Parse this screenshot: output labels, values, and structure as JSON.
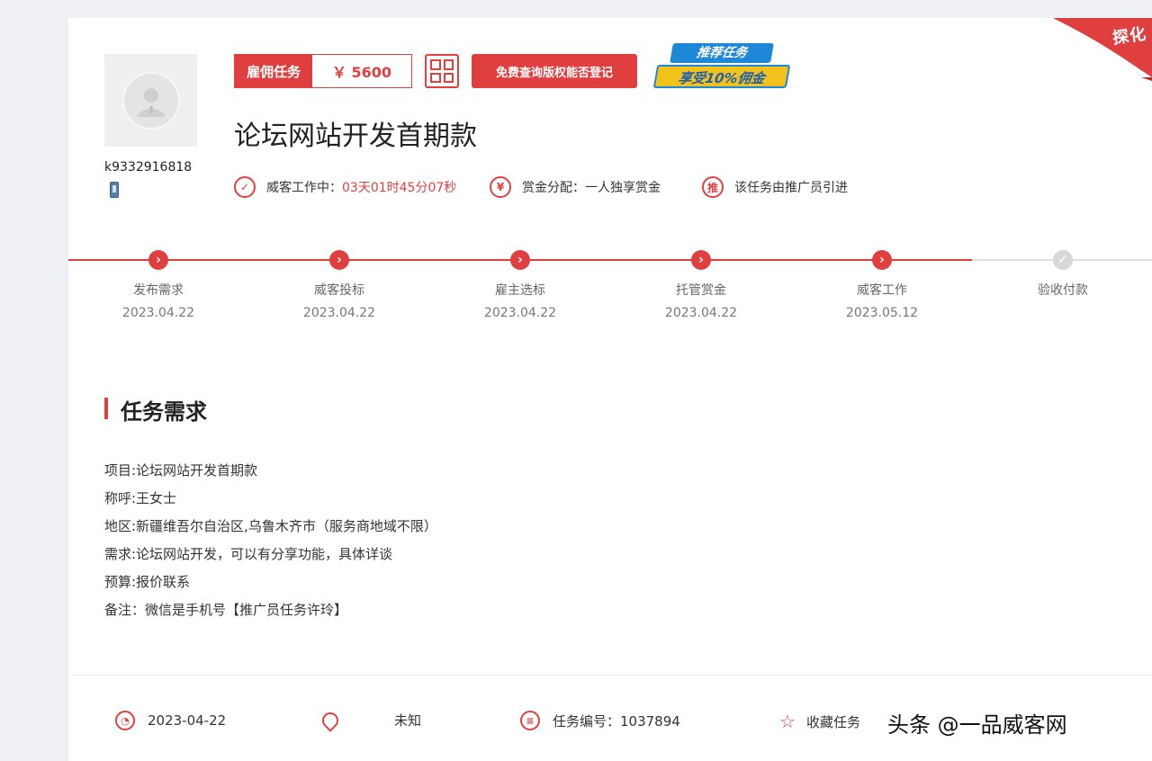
{
  "ribbon": {
    "label": "探化"
  },
  "user": {
    "username": "k9332916818"
  },
  "badges": {
    "task_type": "雇佣任务",
    "price": "￥ 5600",
    "check_copyright": "免费查询版权能否登记",
    "promo_line1": "推荐任务",
    "promo_line2": "享受10%佣金"
  },
  "title": "论坛网站开发首期款",
  "meta": {
    "working_label": "威客工作中：",
    "working_time": "03天01时45分07秒",
    "reward_label": "赏金分配：",
    "reward_value": "一人独享赏金",
    "promoter_text": "该任务由推广员引进"
  },
  "steps": [
    {
      "label": "发布需求",
      "date": "2023.04.22",
      "done": true
    },
    {
      "label": "威客投标",
      "date": "2023.04.22",
      "done": true
    },
    {
      "label": "雇主选标",
      "date": "2023.04.22",
      "done": true
    },
    {
      "label": "托管赏金",
      "date": "2023.04.22",
      "done": true
    },
    {
      "label": "威客工作",
      "date": "2023.05.12",
      "done": true
    },
    {
      "label": "验收付款",
      "date": "",
      "done": false
    }
  ],
  "section": {
    "title": "任务需求"
  },
  "requirements": [
    "项目:论坛网站开发首期款",
    "称呼:王女士",
    "地区:新疆维吾尔自治区,乌鲁木齐市（服务商地域不限）",
    "需求:论坛网站开发，可以有分享功能，具体详谈",
    "预算:报价联系",
    "备注：微信是手机号【推广员任务许玲】"
  ],
  "footer": {
    "date": "2023-04-22",
    "location": "未知",
    "task_number": "任务编号：1037894",
    "favorite": "收藏任务"
  },
  "watermark": "头条 @一品威客网",
  "colors": {
    "accent": "#e03f3f",
    "promo_blue": "#1e88d8",
    "promo_yellow": "#f2c21b"
  }
}
